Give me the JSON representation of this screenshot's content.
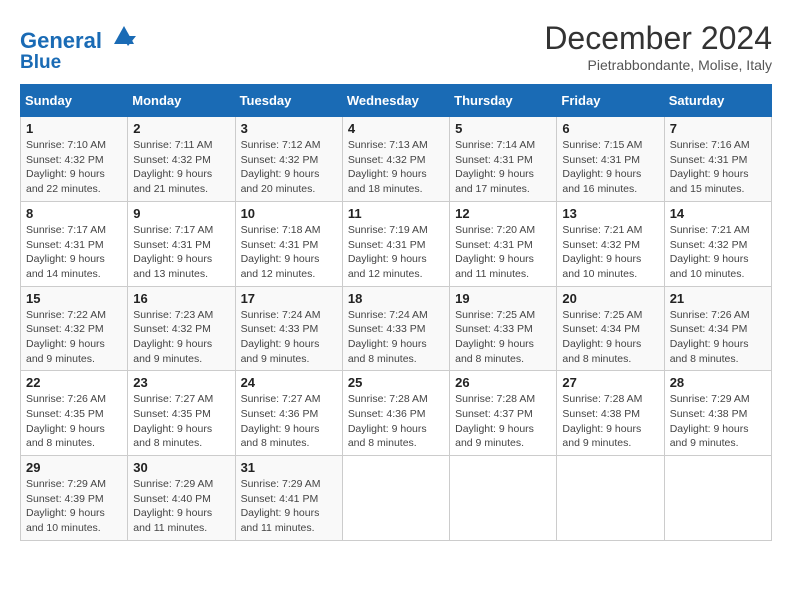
{
  "logo": {
    "line1": "General",
    "line2": "Blue"
  },
  "title": "December 2024",
  "subtitle": "Pietrabbondante, Molise, Italy",
  "days_of_week": [
    "Sunday",
    "Monday",
    "Tuesday",
    "Wednesday",
    "Thursday",
    "Friday",
    "Saturday"
  ],
  "weeks": [
    [
      {
        "day": "1",
        "rise": "Sunrise: 7:10 AM",
        "set": "Sunset: 4:32 PM",
        "daylight": "Daylight: 9 hours and 22 minutes."
      },
      {
        "day": "2",
        "rise": "Sunrise: 7:11 AM",
        "set": "Sunset: 4:32 PM",
        "daylight": "Daylight: 9 hours and 21 minutes."
      },
      {
        "day": "3",
        "rise": "Sunrise: 7:12 AM",
        "set": "Sunset: 4:32 PM",
        "daylight": "Daylight: 9 hours and 20 minutes."
      },
      {
        "day": "4",
        "rise": "Sunrise: 7:13 AM",
        "set": "Sunset: 4:32 PM",
        "daylight": "Daylight: 9 hours and 18 minutes."
      },
      {
        "day": "5",
        "rise": "Sunrise: 7:14 AM",
        "set": "Sunset: 4:31 PM",
        "daylight": "Daylight: 9 hours and 17 minutes."
      },
      {
        "day": "6",
        "rise": "Sunrise: 7:15 AM",
        "set": "Sunset: 4:31 PM",
        "daylight": "Daylight: 9 hours and 16 minutes."
      },
      {
        "day": "7",
        "rise": "Sunrise: 7:16 AM",
        "set": "Sunset: 4:31 PM",
        "daylight": "Daylight: 9 hours and 15 minutes."
      }
    ],
    [
      {
        "day": "8",
        "rise": "Sunrise: 7:17 AM",
        "set": "Sunset: 4:31 PM",
        "daylight": "Daylight: 9 hours and 14 minutes."
      },
      {
        "day": "9",
        "rise": "Sunrise: 7:17 AM",
        "set": "Sunset: 4:31 PM",
        "daylight": "Daylight: 9 hours and 13 minutes."
      },
      {
        "day": "10",
        "rise": "Sunrise: 7:18 AM",
        "set": "Sunset: 4:31 PM",
        "daylight": "Daylight: 9 hours and 12 minutes."
      },
      {
        "day": "11",
        "rise": "Sunrise: 7:19 AM",
        "set": "Sunset: 4:31 PM",
        "daylight": "Daylight: 9 hours and 12 minutes."
      },
      {
        "day": "12",
        "rise": "Sunrise: 7:20 AM",
        "set": "Sunset: 4:31 PM",
        "daylight": "Daylight: 9 hours and 11 minutes."
      },
      {
        "day": "13",
        "rise": "Sunrise: 7:21 AM",
        "set": "Sunset: 4:32 PM",
        "daylight": "Daylight: 9 hours and 10 minutes."
      },
      {
        "day": "14",
        "rise": "Sunrise: 7:21 AM",
        "set": "Sunset: 4:32 PM",
        "daylight": "Daylight: 9 hours and 10 minutes."
      }
    ],
    [
      {
        "day": "15",
        "rise": "Sunrise: 7:22 AM",
        "set": "Sunset: 4:32 PM",
        "daylight": "Daylight: 9 hours and 9 minutes."
      },
      {
        "day": "16",
        "rise": "Sunrise: 7:23 AM",
        "set": "Sunset: 4:32 PM",
        "daylight": "Daylight: 9 hours and 9 minutes."
      },
      {
        "day": "17",
        "rise": "Sunrise: 7:24 AM",
        "set": "Sunset: 4:33 PM",
        "daylight": "Daylight: 9 hours and 9 minutes."
      },
      {
        "day": "18",
        "rise": "Sunrise: 7:24 AM",
        "set": "Sunset: 4:33 PM",
        "daylight": "Daylight: 9 hours and 8 minutes."
      },
      {
        "day": "19",
        "rise": "Sunrise: 7:25 AM",
        "set": "Sunset: 4:33 PM",
        "daylight": "Daylight: 9 hours and 8 minutes."
      },
      {
        "day": "20",
        "rise": "Sunrise: 7:25 AM",
        "set": "Sunset: 4:34 PM",
        "daylight": "Daylight: 9 hours and 8 minutes."
      },
      {
        "day": "21",
        "rise": "Sunrise: 7:26 AM",
        "set": "Sunset: 4:34 PM",
        "daylight": "Daylight: 9 hours and 8 minutes."
      }
    ],
    [
      {
        "day": "22",
        "rise": "Sunrise: 7:26 AM",
        "set": "Sunset: 4:35 PM",
        "daylight": "Daylight: 9 hours and 8 minutes."
      },
      {
        "day": "23",
        "rise": "Sunrise: 7:27 AM",
        "set": "Sunset: 4:35 PM",
        "daylight": "Daylight: 9 hours and 8 minutes."
      },
      {
        "day": "24",
        "rise": "Sunrise: 7:27 AM",
        "set": "Sunset: 4:36 PM",
        "daylight": "Daylight: 9 hours and 8 minutes."
      },
      {
        "day": "25",
        "rise": "Sunrise: 7:28 AM",
        "set": "Sunset: 4:36 PM",
        "daylight": "Daylight: 9 hours and 8 minutes."
      },
      {
        "day": "26",
        "rise": "Sunrise: 7:28 AM",
        "set": "Sunset: 4:37 PM",
        "daylight": "Daylight: 9 hours and 9 minutes."
      },
      {
        "day": "27",
        "rise": "Sunrise: 7:28 AM",
        "set": "Sunset: 4:38 PM",
        "daylight": "Daylight: 9 hours and 9 minutes."
      },
      {
        "day": "28",
        "rise": "Sunrise: 7:29 AM",
        "set": "Sunset: 4:38 PM",
        "daylight": "Daylight: 9 hours and 9 minutes."
      }
    ],
    [
      {
        "day": "29",
        "rise": "Sunrise: 7:29 AM",
        "set": "Sunset: 4:39 PM",
        "daylight": "Daylight: 9 hours and 10 minutes."
      },
      {
        "day": "30",
        "rise": "Sunrise: 7:29 AM",
        "set": "Sunset: 4:40 PM",
        "daylight": "Daylight: 9 hours and 11 minutes."
      },
      {
        "day": "31",
        "rise": "Sunrise: 7:29 AM",
        "set": "Sunset: 4:41 PM",
        "daylight": "Daylight: 9 hours and 11 minutes."
      },
      null,
      null,
      null,
      null
    ]
  ]
}
